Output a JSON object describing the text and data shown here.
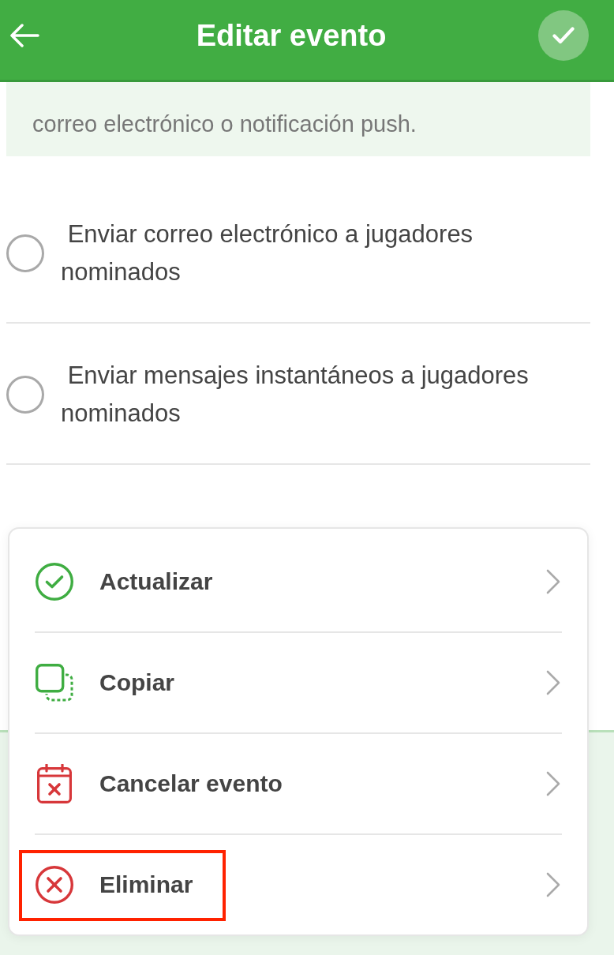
{
  "header": {
    "title": "Editar evento"
  },
  "info_box": {
    "text": "correo electrónico o notificación push."
  },
  "options": [
    {
      "label": " Enviar correo electrónico a jugadores nominados",
      "checked": false
    },
    {
      "label": " Enviar mensajes instantáneos a jugadores nominados",
      "checked": false
    }
  ],
  "action_menu": {
    "items": [
      {
        "kind": "update",
        "label": "Actualizar",
        "highlighted": false
      },
      {
        "kind": "copy",
        "label": "Copiar",
        "highlighted": false
      },
      {
        "kind": "cancel",
        "label": "Cancelar evento",
        "highlighted": false
      },
      {
        "kind": "delete",
        "label": "Eliminar",
        "highlighted": true
      }
    ]
  }
}
